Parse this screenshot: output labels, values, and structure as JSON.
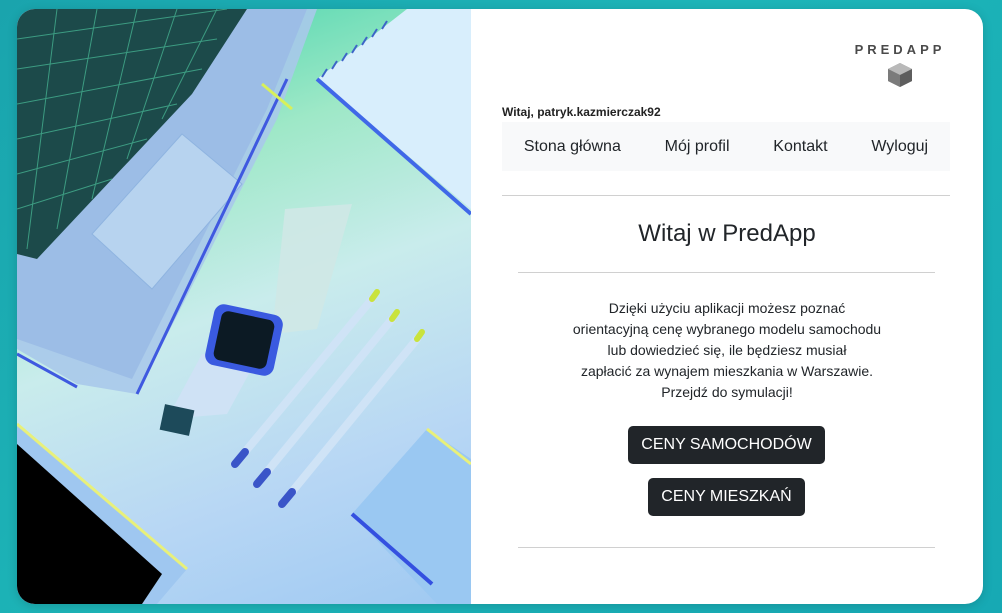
{
  "logo": {
    "text": "PREDAPP",
    "icon": "cube-icon"
  },
  "greeting": "Witaj, patryk.kazmierczak92",
  "nav": {
    "items": [
      {
        "label": "Stona główna"
      },
      {
        "label": "Mój profil"
      },
      {
        "label": "Kontakt"
      },
      {
        "label": "Wyloguj"
      }
    ]
  },
  "main": {
    "title": "Witaj w PredApp",
    "description_lines": [
      "Dzięki użyciu aplikacji możesz poznać",
      "orientacyjną cenę wybranego modelu samochodu",
      "lub dowiedzieć się, ile będziesz musiał",
      "zapłacić za wynajem mieszkania w Warszawie.",
      "Przejdź do symulacji!"
    ],
    "buttons": {
      "cars": "CENY SAMOCHODÓW",
      "flats": "CENY MIESZKAŃ"
    }
  },
  "colors": {
    "background": "#1db5b8",
    "button": "#212529",
    "nav_bg": "#f8f9fa"
  }
}
